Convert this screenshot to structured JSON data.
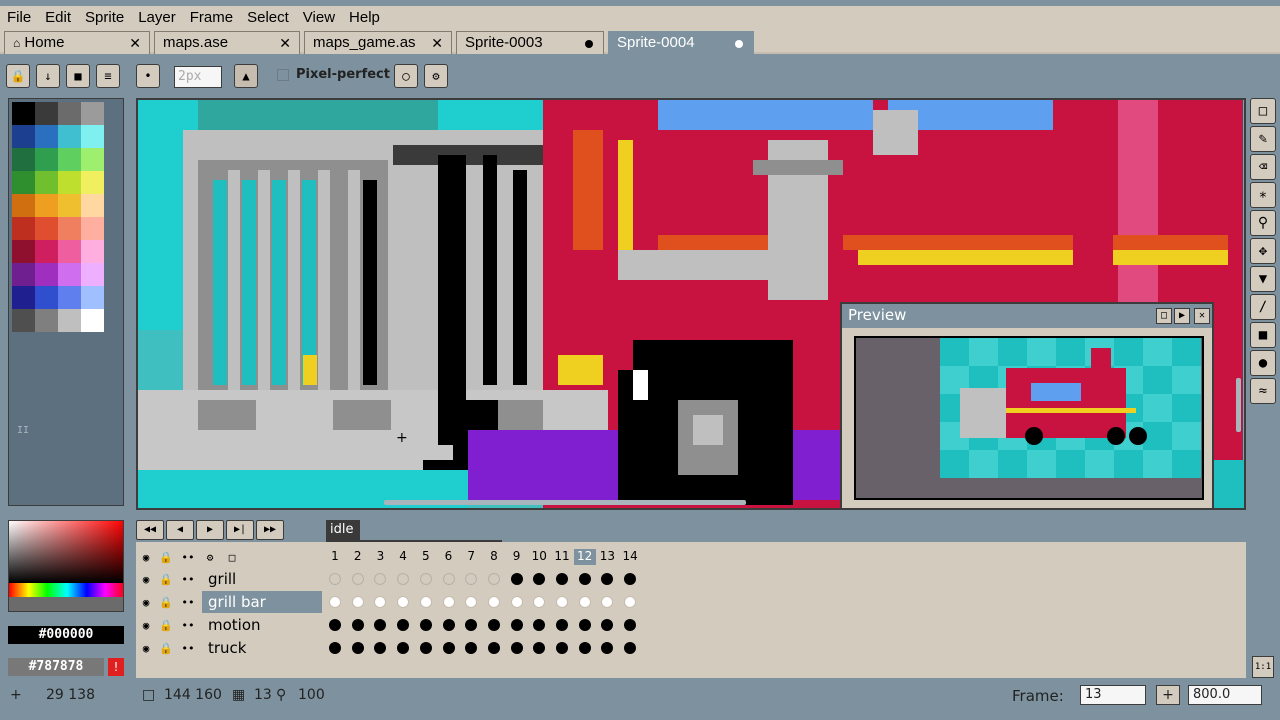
{
  "menu": [
    "File",
    "Edit",
    "Sprite",
    "Layer",
    "Frame",
    "Select",
    "View",
    "Help"
  ],
  "tabs": [
    {
      "label": "Home",
      "icon": "home-icon",
      "action": "close"
    },
    {
      "label": "maps.ase",
      "action": "close"
    },
    {
      "label": "maps_game.as",
      "action": "close"
    },
    {
      "label": "Sprite-0003",
      "action": "modified"
    },
    {
      "label": "Sprite-0004",
      "action": "modified",
      "active": true
    }
  ],
  "options": {
    "brush_size_placeholder": "2px",
    "pixel_perfect_label": "Pixel-perfect"
  },
  "palette": [
    "#000000",
    "#3a3a3a",
    "#6b6b6b",
    "#9b9b9b",
    "#1c3f8f",
    "#2b6fbf",
    "#3fbfcf",
    "#7fefef",
    "#1f6f3f",
    "#2f9f4f",
    "#5fcf5f",
    "#9fef6f",
    "#2f8f2f",
    "#6fbf2f",
    "#bfdf2f",
    "#efef5f",
    "#cf6f0f",
    "#ef9f1f",
    "#efbf2f",
    "#ffd7a0",
    "#bf2f1f",
    "#df4f2f",
    "#ef7f5f",
    "#ffaf9f",
    "#8f0f2f",
    "#cf1f5f",
    "#ef5f9f",
    "#ffafdf",
    "#6f1f8f",
    "#9f2fbf",
    "#cf6fef",
    "#efafff",
    "#1f1f8f",
    "#2f4fcf",
    "#5f7fef",
    "#9fbfff",
    "#4f4f4f",
    "#7f7f7f",
    "#bfbfbf",
    "#ffffff"
  ],
  "colors": {
    "foreground_hex": "#000000",
    "background_hex": "#787878"
  },
  "preview": {
    "title": "Preview"
  },
  "timeline": {
    "tag": "idle",
    "frames": [
      "1",
      "2",
      "3",
      "4",
      "5",
      "6",
      "7",
      "8",
      "9",
      "10",
      "11",
      "12",
      "13",
      "14"
    ],
    "current_frame": 12,
    "layers": [
      {
        "name": "grill",
        "cels": "empty-until-9"
      },
      {
        "name": "grill bar",
        "cels": "white",
        "selected": true
      },
      {
        "name": "motion",
        "cels": "full"
      },
      {
        "name": "truck",
        "cels": "full"
      }
    ]
  },
  "status": {
    "cursor_pos": "29  138",
    "sprite_size": "144 160",
    "frame_count": "13",
    "zoom_pct": "100",
    "frame_label": "Frame:",
    "frame_value": "13",
    "zoom_value": "800.0",
    "one_to_one": "1:1"
  }
}
